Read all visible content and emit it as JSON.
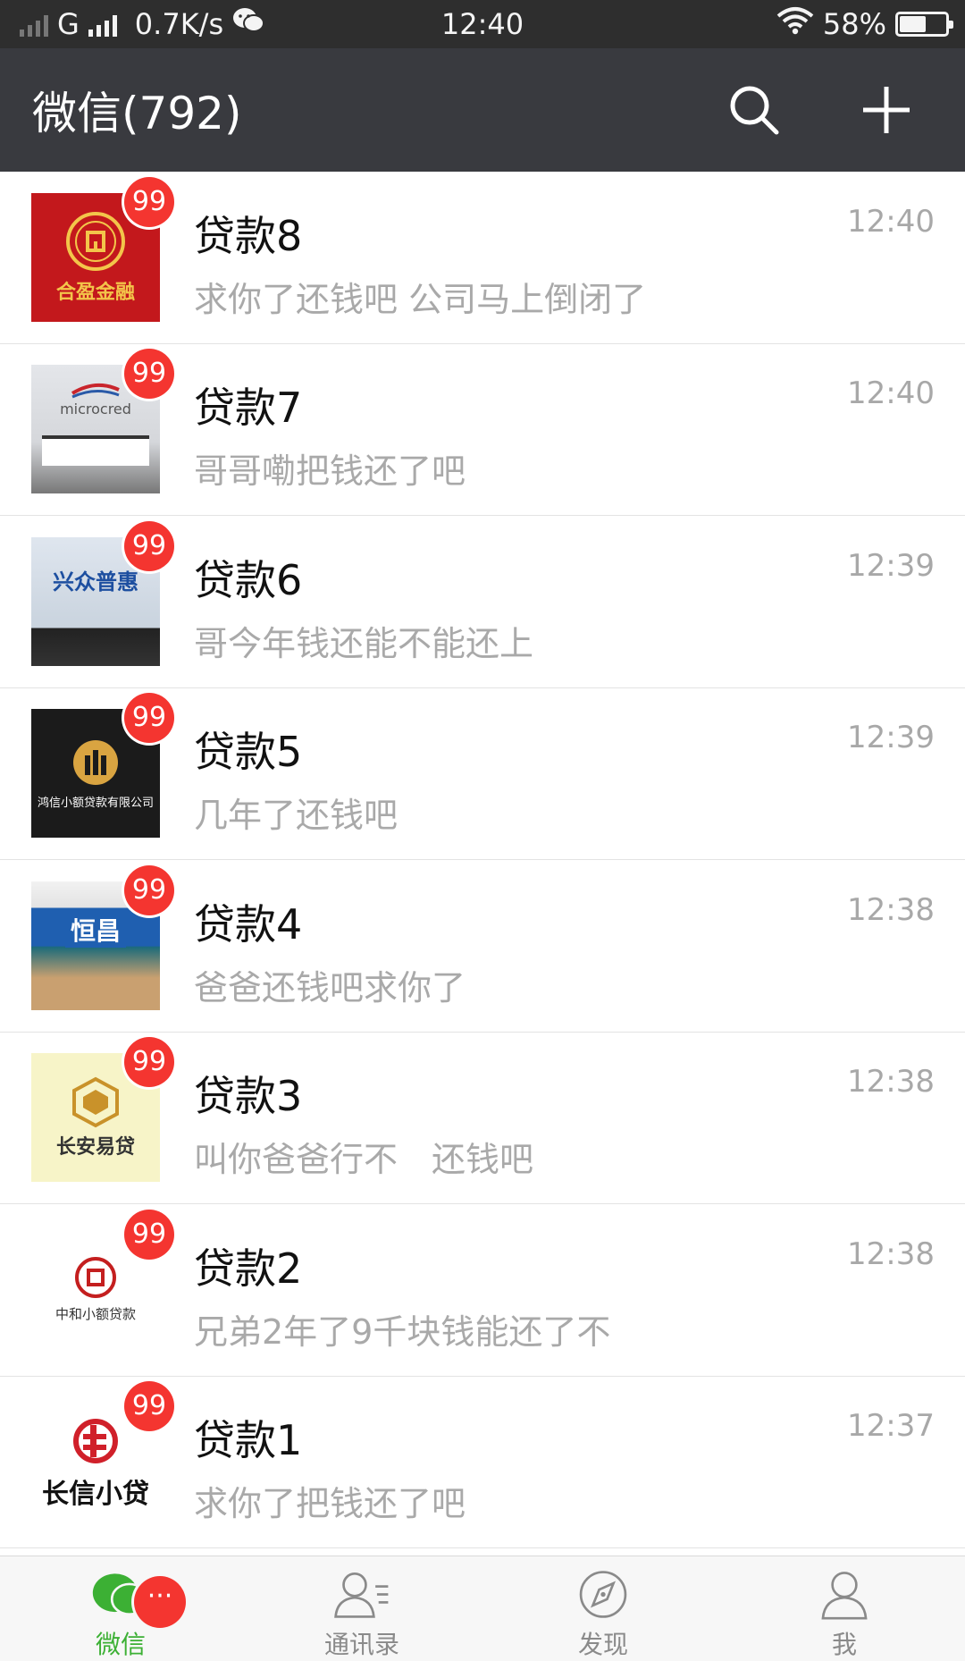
{
  "status_bar": {
    "network": "G",
    "speed": "0.7K/s",
    "time": "12:40",
    "battery": "58%",
    "battery_level": 0.58
  },
  "header": {
    "title": "微信(792)"
  },
  "chats": [
    {
      "name": "贷款8",
      "time": "12:40",
      "preview": "求你了还钱吧 公司马上倒闭了",
      "badge": "99",
      "avatar_text": "合盈金融"
    },
    {
      "name": "贷款7",
      "time": "12:40",
      "preview": "哥哥嘞把钱还了吧",
      "badge": "99",
      "avatar_text": "microcred"
    },
    {
      "name": "贷款6",
      "time": "12:39",
      "preview": "哥今年钱还能不能还上",
      "badge": "99",
      "avatar_text": "兴众普惠"
    },
    {
      "name": "贷款5",
      "time": "12:39",
      "preview": "几年了还钱吧",
      "badge": "99",
      "avatar_text": "鸿信小额贷款有限公司"
    },
    {
      "name": "贷款4",
      "time": "12:38",
      "preview": "爸爸还钱吧求你了",
      "badge": "99",
      "avatar_text": "恒昌"
    },
    {
      "name": "贷款3",
      "time": "12:38",
      "preview": "叫你爸爸行不　还钱吧",
      "badge": "99",
      "avatar_text": "长安易贷"
    },
    {
      "name": "贷款2",
      "time": "12:38",
      "preview": "兄弟2年了9千块钱能还了不",
      "badge": "99",
      "avatar_text": "中和小额贷款"
    },
    {
      "name": "贷款1",
      "time": "12:37",
      "preview": "求你了把钱还了吧",
      "badge": "99",
      "avatar_text": "长信小贷"
    }
  ],
  "tabbar": {
    "tabs": [
      {
        "label": "微信",
        "icon": "chat-bubbles-icon"
      },
      {
        "label": "通讯录",
        "icon": "contacts-icon"
      },
      {
        "label": "发现",
        "icon": "compass-icon"
      },
      {
        "label": "我",
        "icon": "person-icon"
      }
    ],
    "badge": "···"
  },
  "colors": {
    "header_bg": "#393a3f",
    "status_bg": "#2e2e2e",
    "badge_red": "#f43530",
    "wechat_green": "#3cb034",
    "muted_text": "#a9a9a9"
  }
}
